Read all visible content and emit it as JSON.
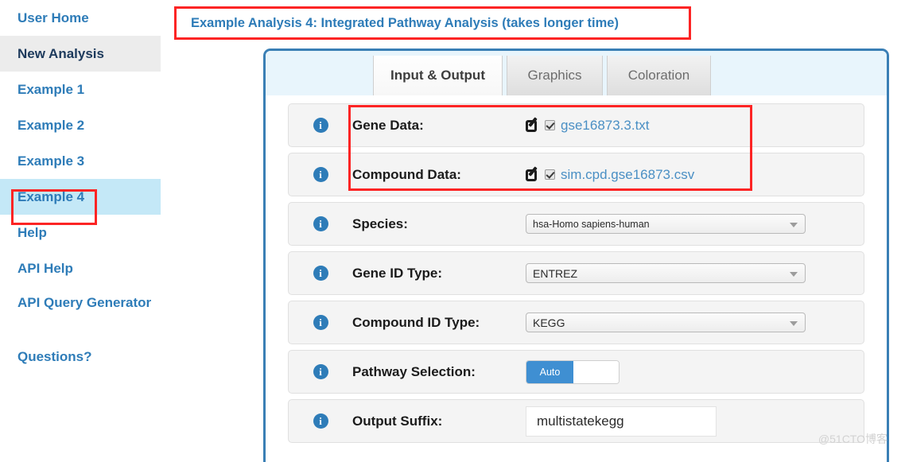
{
  "sidebar": {
    "items": [
      {
        "label": "User Home",
        "state": "link"
      },
      {
        "label": "New Analysis",
        "state": "current"
      },
      {
        "label": "Example 1",
        "state": "link"
      },
      {
        "label": "Example 2",
        "state": "link"
      },
      {
        "label": "Example 3",
        "state": "link"
      },
      {
        "label": "Example 4",
        "state": "selected"
      },
      {
        "label": "Help",
        "state": "link"
      },
      {
        "label": "API Help",
        "state": "link"
      },
      {
        "label": "API Query Generator",
        "state": "link"
      },
      {
        "label": "Questions?",
        "state": "link"
      }
    ]
  },
  "banner": {
    "title": "Example Analysis 4: Integrated Pathway Analysis (takes longer time)"
  },
  "tabs": [
    {
      "label": "Input & Output",
      "active": true
    },
    {
      "label": "Graphics",
      "active": false
    },
    {
      "label": "Coloration",
      "active": false
    }
  ],
  "form": {
    "rows": [
      {
        "label": "Gene Data:",
        "type": "file",
        "value": "gse16873.3.txt",
        "checked": true
      },
      {
        "label": "Compound Data:",
        "type": "file",
        "value": "sim.cpd.gse16873.csv",
        "checked": true
      },
      {
        "label": "Species:",
        "type": "select",
        "value": "hsa-Homo sapiens-human"
      },
      {
        "label": "Gene ID Type:",
        "type": "select",
        "value": "ENTREZ"
      },
      {
        "label": "Compound ID Type:",
        "type": "select",
        "value": "KEGG"
      },
      {
        "label": "Pathway Selection:",
        "type": "toggle",
        "value": "Auto"
      },
      {
        "label": "Output Suffix:",
        "type": "text",
        "value": "multistatekegg"
      }
    ]
  },
  "icons": {
    "info": "i",
    "edit": "edit-pencil-square-icon",
    "checkbox": "checked-checkbox-icon",
    "caret": "chevron-down-icon"
  },
  "watermark": {
    "text": "@51CTO博客"
  },
  "colors": {
    "link_blue": "#2e7cb8",
    "selected_blue": "#c4e8f7",
    "highlight_red": "#fc2424",
    "panel_border": "#3a7fb5",
    "toggle_on": "#3f8fd2"
  }
}
